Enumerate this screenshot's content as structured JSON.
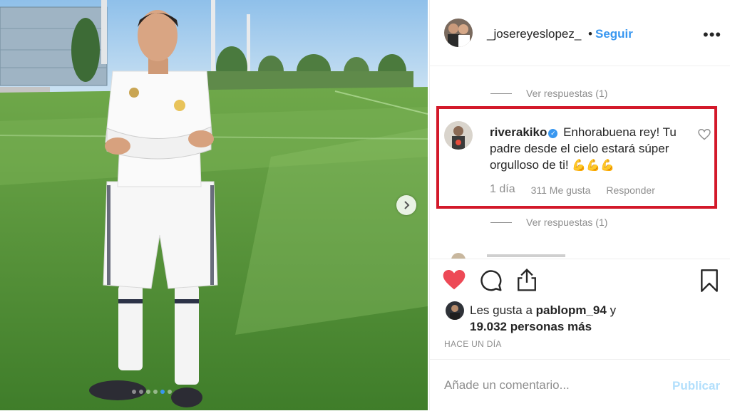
{
  "post": {
    "author": "_josereyeslopez_",
    "separator": "•",
    "follow_label": "Seguir",
    "more_icon": "more-options-icon",
    "carousel": {
      "count": 6,
      "active_index": 4
    }
  },
  "comments": {
    "view_replies_1": "Ver respuestas (1)",
    "highlighted": {
      "username": "riverakiko",
      "verified": true,
      "text_line1": "Enhorabuena rey! Tu",
      "text_line2": "padre desde el cielo estará súper",
      "text_line3": "orgulloso de ti!",
      "emoji": "💪💪💪",
      "time": "1 día",
      "likes": "311 Me gusta",
      "reply_label": "Responder",
      "highlight_color": "#d3192a"
    },
    "view_replies_2": "Ver respuestas (1)"
  },
  "actions": {
    "like_color": "#ed4956",
    "icons": [
      "heart-filled-icon",
      "comment-icon",
      "share-icon",
      "bookmark-icon"
    ]
  },
  "likes": {
    "prefix": "Les gusta a",
    "user": "pablopm_94",
    "conj": "y",
    "count": "19.032 personas más"
  },
  "time_ago": "HACE UN DÍA",
  "add_comment": {
    "placeholder": "Añade un comentario...",
    "publish_label": "Publicar"
  },
  "colors": {
    "link": "#3897f0",
    "muted": "#8e8e8e",
    "publish_disabled": "#b2dffc"
  }
}
